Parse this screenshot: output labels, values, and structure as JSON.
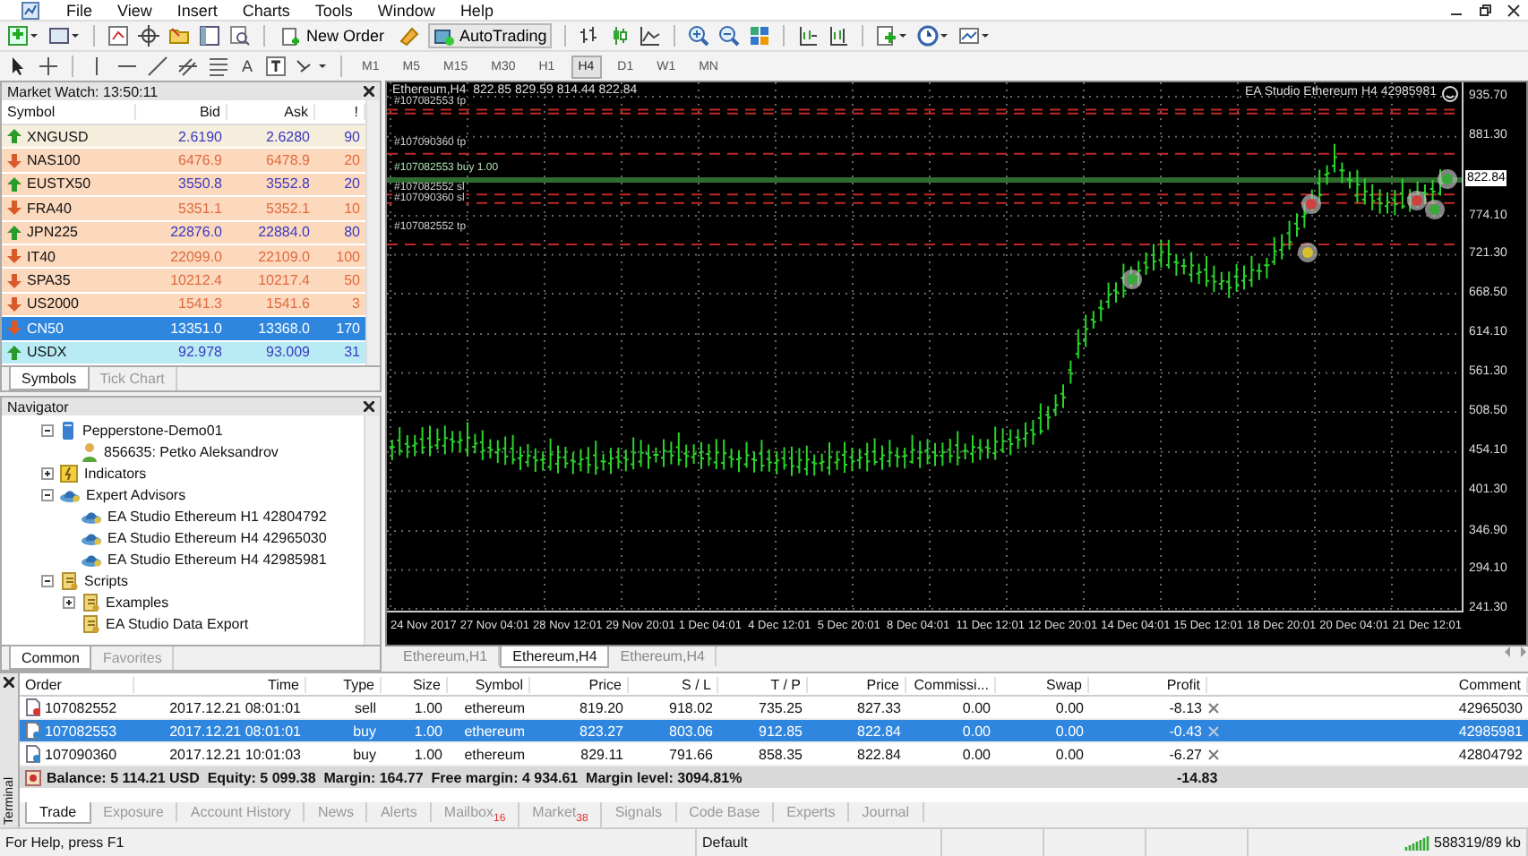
{
  "menu": [
    "File",
    "View",
    "Insert",
    "Charts",
    "Tools",
    "Window",
    "Help"
  ],
  "toolbar": {
    "new_order": "New Order",
    "auto_trading": "AutoTrading",
    "text_tool": "A",
    "timeframes": [
      {
        "label": "M1",
        "selected": false
      },
      {
        "label": "M5",
        "selected": false
      },
      {
        "label": "M15",
        "selected": false
      },
      {
        "label": "M30",
        "selected": false
      },
      {
        "label": "H1",
        "selected": false
      },
      {
        "label": "H4",
        "selected": true
      },
      {
        "label": "D1",
        "selected": false
      },
      {
        "label": "W1",
        "selected": false
      },
      {
        "label": "MN",
        "selected": false
      }
    ]
  },
  "market_watch": {
    "title": "Market Watch: 13:50:11",
    "columns": [
      "Symbol",
      "Bid",
      "Ask",
      "!"
    ],
    "rows": [
      {
        "symbol": "XNGUSD",
        "bid": "2.6190",
        "ask": "2.6280",
        "spread": "90",
        "rising": true,
        "selected": false,
        "color": "#f6eedd"
      },
      {
        "symbol": "NAS100",
        "bid": "6476.9",
        "ask": "6478.9",
        "spread": "20",
        "rising": false,
        "selected": false,
        "color": "#fcd8bd"
      },
      {
        "symbol": "EUSTX50",
        "bid": "3550.8",
        "ask": "3552.8",
        "spread": "20",
        "rising": true,
        "selected": false,
        "color": "#fcd8bd"
      },
      {
        "symbol": "FRA40",
        "bid": "5351.1",
        "ask": "5352.1",
        "spread": "10",
        "rising": false,
        "selected": false,
        "color": "#fcd8bd"
      },
      {
        "symbol": "JPN225",
        "bid": "22876.0",
        "ask": "22884.0",
        "spread": "80",
        "rising": true,
        "selected": false,
        "color": "#fcd8bd"
      },
      {
        "symbol": "IT40",
        "bid": "22099.0",
        "ask": "22109.0",
        "spread": "100",
        "rising": false,
        "selected": false,
        "color": "#fcd8bd"
      },
      {
        "symbol": "SPA35",
        "bid": "10212.4",
        "ask": "10217.4",
        "spread": "50",
        "rising": false,
        "selected": false,
        "color": "#fcd8bd"
      },
      {
        "symbol": "US2000",
        "bid": "1541.3",
        "ask": "1541.6",
        "spread": "3",
        "rising": false,
        "selected": false,
        "color": "#fcd8bd"
      },
      {
        "symbol": "CN50",
        "bid": "13351.0",
        "ask": "13368.0",
        "spread": "170",
        "rising": false,
        "selected": true
      },
      {
        "symbol": "USDX",
        "bid": "92.978",
        "ask": "93.009",
        "spread": "31",
        "rising": true,
        "selected": false,
        "color": "#b8ebf3"
      }
    ],
    "tabs": [
      {
        "label": "Symbols",
        "selected": true
      },
      {
        "label": "Tick Chart",
        "selected": false
      }
    ]
  },
  "navigator": {
    "title": "Navigator",
    "tree": [
      {
        "label": "Pepperstone-Demo01",
        "kind": "server",
        "expanded": true,
        "children": [
          {
            "label": "856635: Petko Aleksandrov",
            "kind": "account"
          }
        ]
      },
      {
        "label": "Indicators",
        "kind": "indicators",
        "expanded": false
      },
      {
        "label": "Expert Advisors",
        "kind": "experts",
        "expanded": true,
        "children": [
          {
            "label": "EA Studio Ethereum H1 42804792",
            "kind": "expert"
          },
          {
            "label": "EA Studio Ethereum H4 42965030",
            "kind": "expert"
          },
          {
            "label": "EA Studio Ethereum H4 42985981",
            "kind": "expert"
          }
        ]
      },
      {
        "label": "Scripts",
        "kind": "scripts",
        "expanded": true,
        "children": [
          {
            "label": "Examples",
            "kind": "scripts",
            "expanded": false
          },
          {
            "label": "EA Studio Data Export",
            "kind": "script"
          }
        ]
      }
    ],
    "tabs": [
      {
        "label": "Common",
        "selected": true
      },
      {
        "label": "Favorites",
        "selected": false
      }
    ]
  },
  "chart": {
    "header": "Ethereum,H4  822.85 829.59 814.44 822.84",
    "ea_label": "EA Studio Ethereum H4 42985981",
    "order_labels": [
      {
        "text": "#107082553 tp",
        "kind": "tp"
      },
      {
        "text": "#107090360 tp",
        "kind": "tp"
      },
      {
        "text": "#107082553 buy 1.00",
        "kind": "open"
      },
      {
        "text": "#107082552 sl",
        "kind": "sl"
      },
      {
        "text": "#107090360 sl",
        "kind": "sl"
      },
      {
        "text": "#107082552 tp",
        "kind": "tp"
      }
    ],
    "current_price": "822.84",
    "price_axis": [
      "935.70",
      "881.30",
      "774.10",
      "721.30",
      "668.50",
      "614.10",
      "561.30",
      "508.50",
      "454.10",
      "401.30",
      "346.90",
      "294.10",
      "241.30"
    ],
    "time_axis": [
      "24 Nov 2017",
      "27 Nov 04:01",
      "28 Nov 12:01",
      "29 Nov 20:01",
      "1 Dec 04:01",
      "4 Dec 12:01",
      "5 Dec 20:01",
      "8 Dec 04:01",
      "11 Dec 12:01",
      "12 Dec 20:01",
      "14 Dec 04:01",
      "15 Dec 12:01",
      "18 Dec 20:01",
      "20 Dec 04:01",
      "21 Dec 12:01"
    ],
    "tabs": [
      {
        "label": "Ethereum,H1",
        "selected": false
      },
      {
        "label": "Ethereum,H4",
        "selected": true
      },
      {
        "label": "Ethereum,H4",
        "selected": false
      }
    ]
  },
  "terminal": {
    "title": "Terminal",
    "columns": [
      "Order",
      "Time",
      "Type",
      "Size",
      "Symbol",
      "Price",
      "S / L",
      "T / P",
      "Price",
      "Commissi...",
      "Swap",
      "Profit",
      "Comment"
    ],
    "rows": [
      {
        "kind": "sell",
        "selected": false,
        "cells": [
          "107082552",
          "2017.12.21 08:01:01",
          "sell",
          "1.00",
          "ethereum",
          "819.20",
          "918.02",
          "735.25",
          "827.33",
          "0.00",
          "0.00",
          "-8.13",
          "42965030"
        ]
      },
      {
        "kind": "buy",
        "selected": true,
        "cells": [
          "107082553",
          "2017.12.21 08:01:01",
          "buy",
          "1.00",
          "ethereum",
          "823.27",
          "803.06",
          "912.85",
          "822.84",
          "0.00",
          "0.00",
          "-0.43",
          "42985981"
        ]
      },
      {
        "kind": "buy",
        "selected": false,
        "cells": [
          "107090360",
          "2017.12.21 10:01:03",
          "buy",
          "1.00",
          "ethereum",
          "829.11",
          "791.66",
          "858.35",
          "822.84",
          "0.00",
          "0.00",
          "-6.27",
          "42804792"
        ]
      }
    ],
    "summary": {
      "text": "Balance: 5 114.21 USD  Equity: 5 099.38  Margin: 164.77  Free margin: 4 934.61  Margin level: 3094.81%",
      "profit": "-14.83"
    },
    "tabs": [
      {
        "label": "Trade",
        "selected": true
      },
      {
        "label": "Exposure",
        "selected": false
      },
      {
        "label": "Account History",
        "selected": false
      },
      {
        "label": "News",
        "selected": false
      },
      {
        "label": "Alerts",
        "selected": false
      },
      {
        "label": "Mailbox",
        "badge": "16",
        "selected": false
      },
      {
        "label": "Market",
        "badge": "38",
        "selected": false
      },
      {
        "label": "Signals",
        "selected": false
      },
      {
        "label": "Code Base",
        "selected": false
      },
      {
        "label": "Experts",
        "selected": false
      },
      {
        "label": "Journal",
        "selected": false
      }
    ]
  },
  "status_bar": {
    "help": "For Help, press F1",
    "profile": "Default",
    "traffic": "588319/89 kb"
  }
}
